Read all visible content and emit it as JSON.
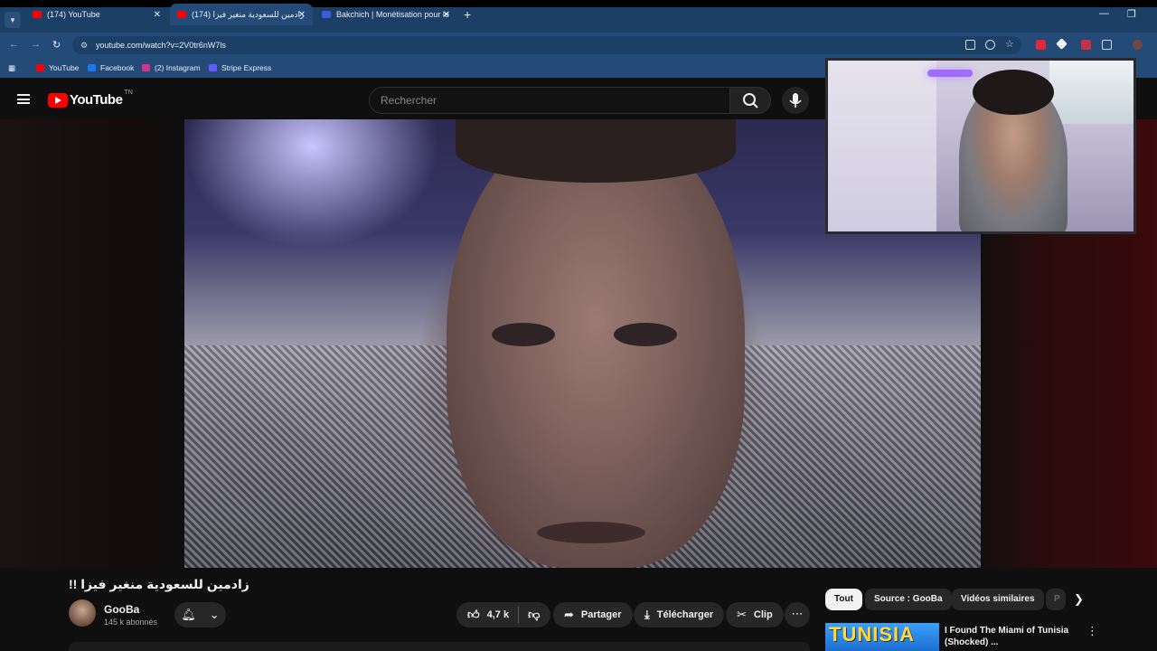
{
  "browser": {
    "tabs": [
      {
        "title": "(174) YouTube",
        "color": "#ff0000"
      },
      {
        "title": "(174) زادمين للسعودية منغير فيزا",
        "color": "#ff0000"
      },
      {
        "title": "Bakchich | Monétisation pour le",
        "color": "#3b5bd9"
      }
    ],
    "new_tab": "+",
    "url": "youtube.com/watch?v=2V0tr6nW7ls",
    "bookmarks": [
      "YouTube",
      "Facebook",
      "(2) Instagram",
      "Stripe Express"
    ]
  },
  "youtube": {
    "logo_text": "YouTube",
    "country_code": "TN",
    "search_placeholder": "Rechercher"
  },
  "video": {
    "title": "زادمين للسعودية منغير فيزا !!",
    "channel": "GooBa",
    "subscribers": "145 k abonnés",
    "likes": "4,7 k",
    "share_label": "Partager",
    "download_label": "Télécharger",
    "clip_label": "Clip"
  },
  "sidebar": {
    "chips": [
      "Tout",
      "Source : GooBa",
      "Vidéos similaires",
      "P"
    ],
    "recommended": {
      "thumb_text": "TUNISIA",
      "title": "I Found The Miami of Tunisia (Shocked) ...",
      "title_short": "I Found The Miami of Tunisia"
    }
  },
  "icons": {
    "menu": "hamburger-icon",
    "search": "search-icon",
    "mic": "mic-icon",
    "like": "thumbs-up-icon",
    "dislike": "thumbs-down-icon",
    "share": "share-arrow-icon",
    "download": "download-icon",
    "clip": "scissors-icon",
    "bell": "bell-icon"
  },
  "colors": {
    "chrome_accent": "#244b78",
    "youtube_red": "#ff0000",
    "background": "#0f0f0f"
  }
}
